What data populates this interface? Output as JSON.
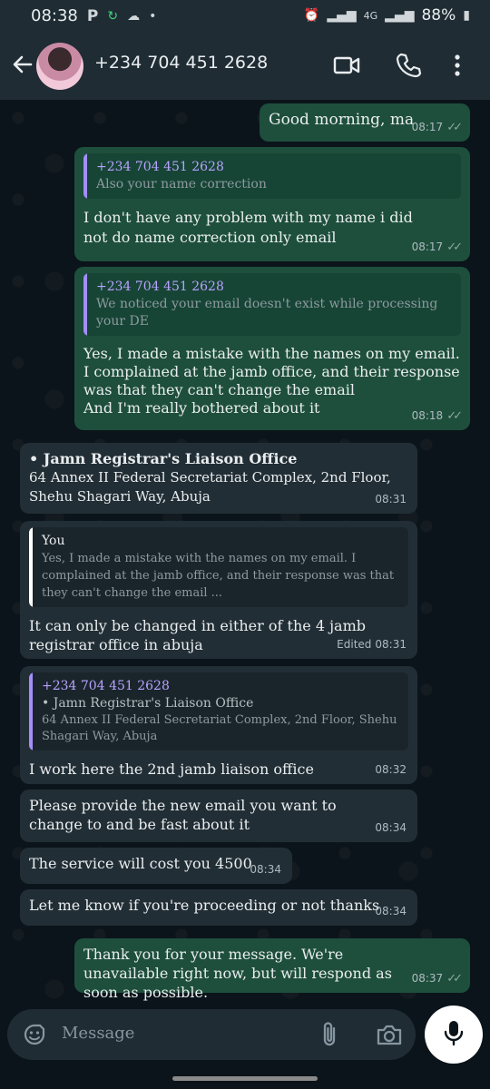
{
  "status_bar": {
    "time": "08:38",
    "left_icons": [
      "p-icon",
      "sync-icon",
      "cloud-icon",
      "dot-icon"
    ],
    "network": "4G",
    "battery": "88%"
  },
  "header": {
    "contact": "+234 704 451 2628",
    "icons": [
      "back-arrow-icon",
      "video-call-icon",
      "phone-call-icon",
      "more-options-icon"
    ]
  },
  "messages": [
    {
      "dir": "out",
      "text": "Good morning, ma",
      "time": "08:17"
    },
    {
      "dir": "out",
      "quote_author": "+234 704 451 2628",
      "quote_text": "Also your name correction",
      "text": "I don't have any problem with my name i did not do name correction only email",
      "time": "08:17"
    },
    {
      "dir": "out",
      "quote_author": "+234 704 451 2628",
      "quote_text": "We noticed your email doesn't exist while processing your DE",
      "text_lines": [
        "Yes, I made a mistake with the names on my email.",
        "I complained at the jamb office, and their response was that they can't change the email",
        "And I'm really bothered about it"
      ],
      "time": "08:18"
    },
    {
      "dir": "in",
      "title": "•  Jamn Registrar's Liaison Office",
      "text": "64 Annex II Federal Secretariat Complex, 2nd Floor, Shehu Shagari Way, Abuja",
      "time": "08:31"
    },
    {
      "dir": "in",
      "quote_author": "You",
      "quote_text": "Yes, I made a mistake with the names on my email. I complained at the jamb office, and their response was that they can't change the email ...",
      "text": "It can only be changed in either of the 4 jamb registrar office in abuja",
      "edited": "Edited",
      "time": "08:31"
    },
    {
      "dir": "in",
      "quote_author": "+234 704 451 2628",
      "quote_title": "•  Jamn Registrar's Liaison Office",
      "quote_text": "64 Annex II Federal Secretariat Complex, 2nd Floor, Shehu Shagari Way, Abuja",
      "text": "I work here the 2nd jamb  liaison office",
      "time": "08:32"
    },
    {
      "dir": "in",
      "text": "Please provide the new email you want to change to and be fast about it",
      "time": "08:34"
    },
    {
      "dir": "in",
      "text": "The service will cost you 4500",
      "time": "08:34"
    },
    {
      "dir": "in",
      "text": "Let me know if you're proceeding or not thanks",
      "time": "08:34"
    },
    {
      "dir": "out",
      "text": "Thank you for your message. We're unavailable right now, but will respond as soon as possible.",
      "time": "08:37"
    }
  ],
  "input": {
    "placeholder": "Message",
    "icons": [
      "emoji-sticker-icon",
      "attach-icon",
      "camera-icon",
      "mic-icon"
    ]
  },
  "colors": {
    "outgoing_bubble": "#1e4f3c",
    "incoming_bubble": "#222e35",
    "quote_bar": "#a58dfa",
    "background": "#0b141a"
  }
}
